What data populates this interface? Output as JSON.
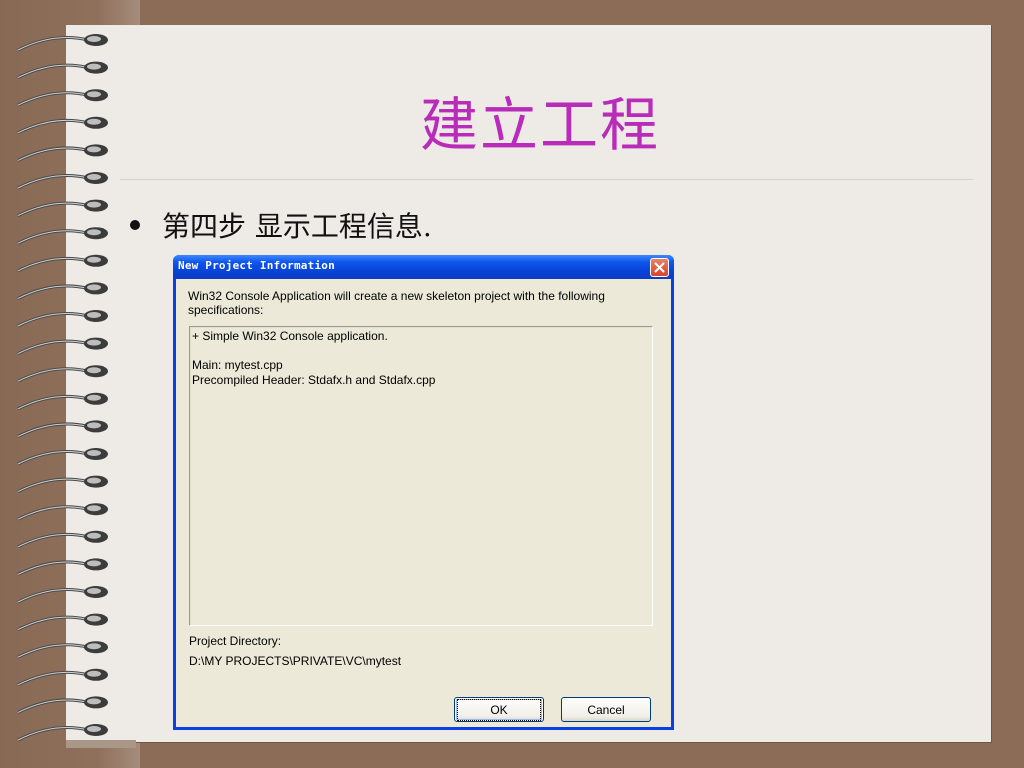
{
  "slide": {
    "title": "建立工程",
    "bullet": "第四步 显示工程信息."
  },
  "dialog": {
    "title": "New Project Information",
    "description": "Win32 Console Application will create a new skeleton project with the following specifications:",
    "info_lines": "+ Simple Win32 Console application.\n\nMain: mytest.cpp\nPrecompiled Header: Stdafx.h and Stdafx.cpp",
    "project_directory_label": "Project Directory:",
    "project_directory_value": "D:\\MY PROJECTS\\PRIVATE\\VC\\mytest",
    "ok_label": "OK",
    "cancel_label": "Cancel",
    "close_icon": "close-icon"
  },
  "colors": {
    "title_color": "#b92bb9",
    "xp_titlebar": "#0842d6",
    "dialog_face": "#ece9d8",
    "page": "#eeeae6",
    "background": "#8c6c57"
  }
}
